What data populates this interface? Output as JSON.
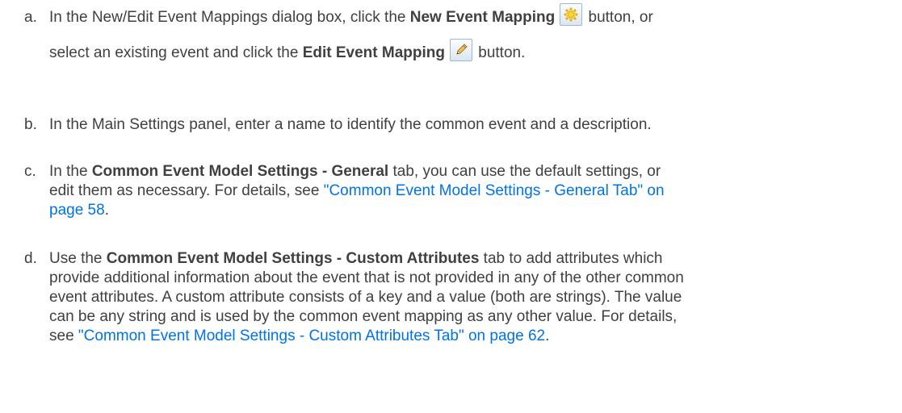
{
  "steps": [
    {
      "marker": "a.",
      "line1_pre": "In the New/Edit Event Mappings dialog box, click the ",
      "line1_bold": "New Event Mapping",
      "line1_post": " button, or",
      "line2_pre": "select an existing event and click the ",
      "line2_bold": "Edit Event Mapping",
      "line2_post": " button.",
      "icons": [
        "new-star-icon",
        "edit-pencil-icon"
      ]
    },
    {
      "marker": "b.",
      "text": "In the Main Settings panel, enter a name to identify the common event and a description."
    },
    {
      "marker": "c.",
      "pre": "In the ",
      "bold": "Common Event Model Settings - General",
      "line1_post": " tab, you can use the default settings, or",
      "line2_pre": "edit them as necessary. For details, see ",
      "link_part1": "\"Common Event Model Settings - General Tab\" on",
      "link_part2": "page 58",
      "line3_post": "."
    },
    {
      "marker": "d.",
      "pre": "Use the ",
      "bold": "Common Event Model Settings - Custom Attributes",
      "line1_post": " tab to add attributes which",
      "line2": "provide additional information about the event that is not provided in any of the other common",
      "line3": "event attributes. A custom attribute consists of a key and a value (both are strings). The value",
      "line4": "can be any string and is used by the common event mapping as any other value. For details,",
      "line5_pre": "see ",
      "link": "\"Common Event Model Settings - Custom Attributes Tab\" on page 62",
      "line5_post": "."
    }
  ],
  "colors": {
    "text": "#404040",
    "link": "#0073e7"
  }
}
